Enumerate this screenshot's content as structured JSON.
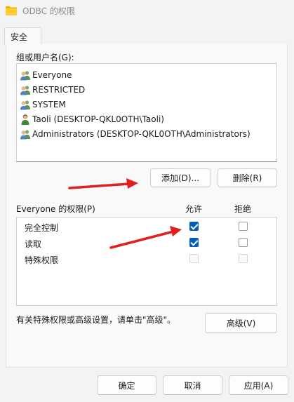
{
  "window": {
    "title": "ODBC 的权限"
  },
  "tabs": [
    {
      "label": "安全"
    }
  ],
  "users_section": {
    "label": "组或用户名(G):",
    "items": [
      {
        "name": "Everyone",
        "icon": "group-icon"
      },
      {
        "name": "RESTRICTED",
        "icon": "group-icon"
      },
      {
        "name": "SYSTEM",
        "icon": "group-icon"
      },
      {
        "name": "Taoli (DESKTOP-QKL0OTH\\Taoli)",
        "icon": "user-icon"
      },
      {
        "name": "Administrators (DESKTOP-QKL0OTH\\Administrators)",
        "icon": "group-icon"
      }
    ],
    "add_label": "添加(D)...",
    "remove_label": "删除(R)"
  },
  "permissions": {
    "label": "Everyone 的权限(P)",
    "allow_header": "允许",
    "deny_header": "拒绝",
    "rows": [
      {
        "name": "完全控制",
        "allow": true,
        "deny": false,
        "enabled": true
      },
      {
        "name": "读取",
        "allow": true,
        "deny": false,
        "enabled": true
      },
      {
        "name": "特殊权限",
        "allow": false,
        "deny": false,
        "enabled": false
      }
    ]
  },
  "advanced": {
    "hint": "有关特殊权限或高级设置，请单击\"高级\"。",
    "button_label": "高级(V)"
  },
  "footer": {
    "ok_label": "确定",
    "cancel_label": "取消",
    "apply_label": "应用(A)"
  },
  "colors": {
    "accent": "#005fb8",
    "annotation": "#e02020"
  }
}
